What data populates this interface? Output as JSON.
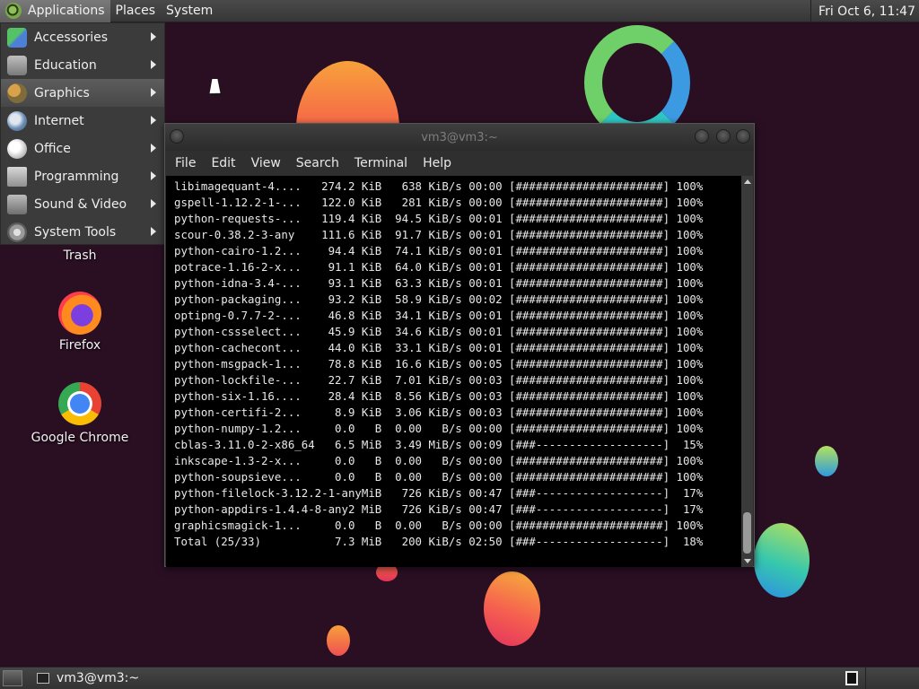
{
  "top_panel": {
    "menus": [
      "Applications",
      "Places",
      "System"
    ],
    "clock": "Fri Oct  6, 11:47"
  },
  "app_menu": {
    "items": [
      {
        "label": "Accessories",
        "icon": "accessories-icon"
      },
      {
        "label": "Education",
        "icon": "education-icon"
      },
      {
        "label": "Graphics",
        "icon": "graphics-icon",
        "selected": true
      },
      {
        "label": "Internet",
        "icon": "internet-icon"
      },
      {
        "label": "Office",
        "icon": "office-icon"
      },
      {
        "label": "Programming",
        "icon": "programming-icon"
      },
      {
        "label": "Sound & Video",
        "icon": "sound-video-icon"
      },
      {
        "label": "System Tools",
        "icon": "system-tools-icon"
      }
    ]
  },
  "desktop": {
    "icons": [
      {
        "label": "Trash"
      },
      {
        "label": "Firefox"
      },
      {
        "label": "Google Chrome"
      }
    ]
  },
  "terminal": {
    "title": "vm3@vm3:~",
    "menu": [
      "File",
      "Edit",
      "View",
      "Search",
      "Terminal",
      "Help"
    ],
    "lines": [
      "libimagequant-4....   274.2 KiB   638 KiB/s 00:00 [######################] 100%",
      "gspell-1.12.2-1-...   122.0 KiB   281 KiB/s 00:00 [######################] 100%",
      "python-requests-...   119.4 KiB  94.5 KiB/s 00:01 [######################] 100%",
      "scour-0.38.2-3-any    111.6 KiB  91.7 KiB/s 00:01 [######################] 100%",
      "python-cairo-1.2...    94.4 KiB  74.1 KiB/s 00:01 [######################] 100%",
      "potrace-1.16-2-x...    91.1 KiB  64.0 KiB/s 00:01 [######################] 100%",
      "python-idna-3.4-...    93.1 KiB  63.3 KiB/s 00:01 [######################] 100%",
      "python-packaging...    93.2 KiB  58.9 KiB/s 00:02 [######################] 100%",
      "optipng-0.7.7-2-...    46.8 KiB  34.1 KiB/s 00:01 [######################] 100%",
      "python-cssselect...    45.9 KiB  34.6 KiB/s 00:01 [######################] 100%",
      "python-cachecont...    44.0 KiB  33.1 KiB/s 00:01 [######################] 100%",
      "python-msgpack-1...    78.8 KiB  16.6 KiB/s 00:05 [######################] 100%",
      "python-lockfile-...    22.7 KiB  7.01 KiB/s 00:03 [######################] 100%",
      "python-six-1.16....    28.4 KiB  8.56 KiB/s 00:03 [######################] 100%",
      "python-certifi-2...     8.9 KiB  3.06 KiB/s 00:03 [######################] 100%",
      "python-numpy-1.2...     0.0   B  0.00   B/s 00:00 [######################] 100%",
      "cblas-3.11.0-2-x86_64   6.5 MiB  3.49 MiB/s 00:09 [###-------------------]  15%",
      "inkscape-1.3-2-x...     0.0   B  0.00   B/s 00:00 [######################] 100%",
      "python-soupsieve...     0.0   B  0.00   B/s 00:00 [######################] 100%",
      "python-filelock-3.12.2-1-anyMiB   726 KiB/s 00:47 [###-------------------]  17%",
      "python-appdirs-1.4.4-8-any2 MiB   726 KiB/s 00:47 [###-------------------]  17%",
      "graphicsmagick-1...     0.0   B  0.00   B/s 00:00 [######################] 100%",
      "Total (25/33)           7.3 MiB   200 KiB/s 02:50 [###-------------------]  18%"
    ]
  },
  "bottom_panel": {
    "task": "vm3@vm3:~"
  },
  "colors": {
    "desktop_bg": "#2a0f23",
    "panel_bg": "#3c3c3c",
    "terminal_bg": "#000000"
  }
}
